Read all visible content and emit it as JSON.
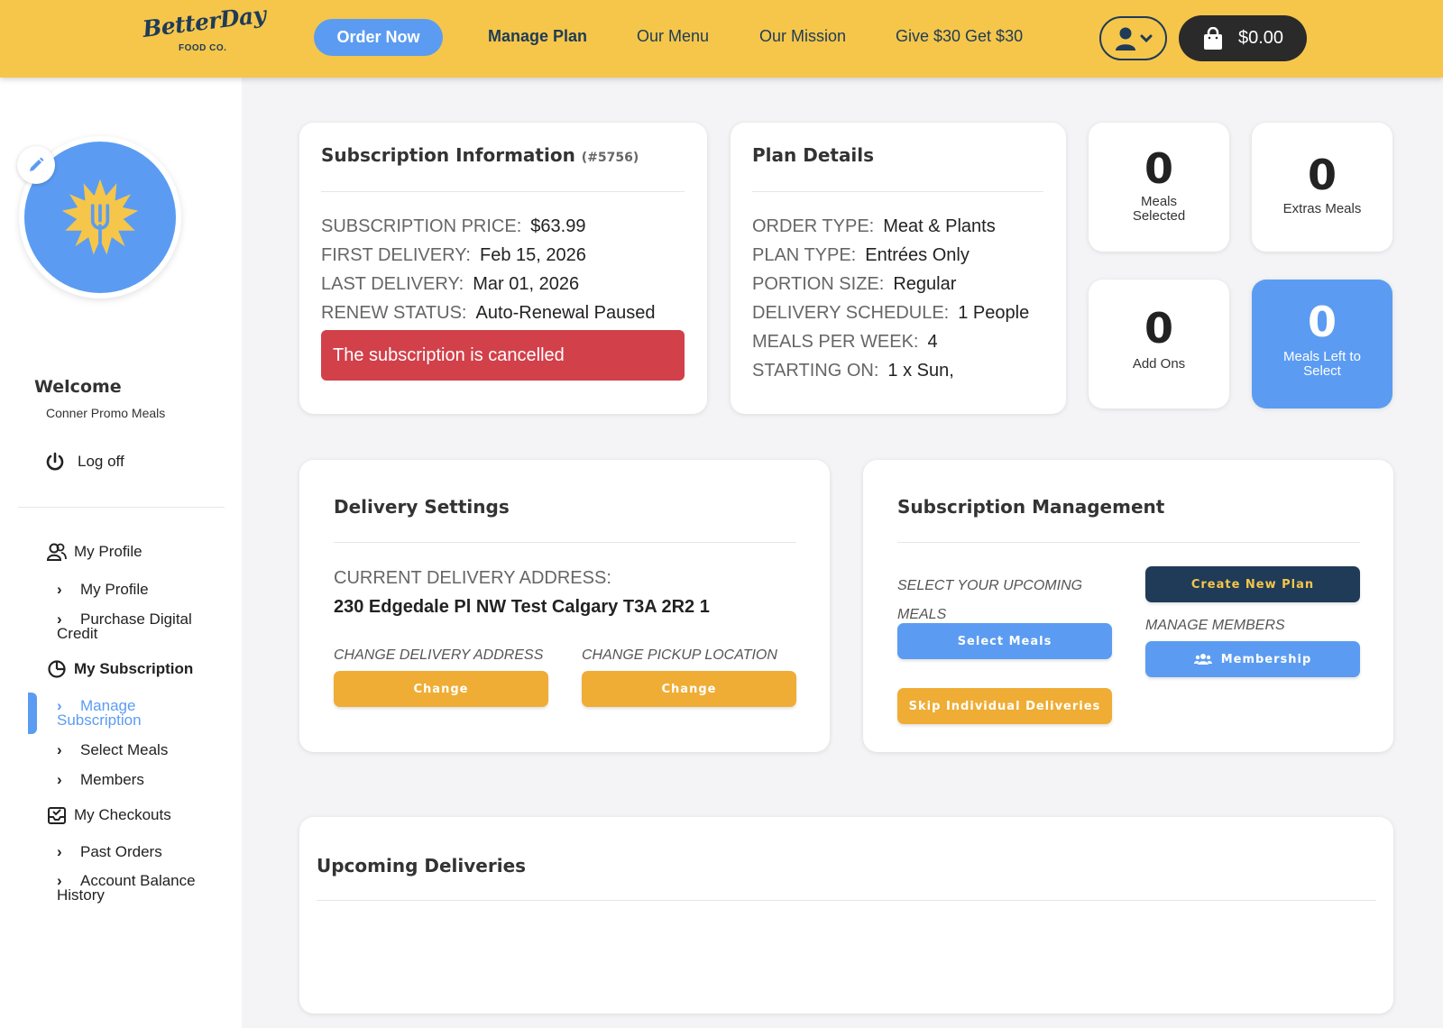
{
  "header": {
    "logo_main": "BetterDay",
    "logo_sub": "FOOD CO.",
    "order_now": "Order Now",
    "nav": [
      "Manage Plan",
      "Our Menu",
      "Our Mission",
      "Give $30 Get $30"
    ],
    "cart_total": "$0.00"
  },
  "colors": {
    "accent_yellow": "#f5c64a",
    "accent_blue": "#5b9cf2",
    "navy": "#1f3b57",
    "alert_red": "#d2404a",
    "button_orange": "#efad35"
  },
  "sidebar": {
    "welcome": "Welcome",
    "username": "Conner Promo Meals",
    "logoff": "Log off",
    "sections": [
      {
        "label": "My Profile",
        "icon": "users-icon"
      },
      {
        "label": "My Subscription",
        "icon": "pie-chart-icon"
      },
      {
        "label": "My Checkouts",
        "icon": "inbox-check-icon"
      }
    ],
    "subs": {
      "my_profile": "My Profile",
      "purchase_credit_1": "Purchase Digital",
      "purchase_credit_2": "Credit",
      "manage_sub_1": "Manage",
      "manage_sub_2": "Subscription",
      "select_meals": "Select Meals",
      "members": "Members",
      "past_orders": "Past Orders",
      "balance_history_1": "Account Balance",
      "balance_history_2": "History"
    }
  },
  "subscription": {
    "title": "Subscription Information",
    "id": "(#5756)",
    "rows": [
      {
        "label": "SUBSCRIPTION PRICE:",
        "value": "$63.99"
      },
      {
        "label": "FIRST DELIVERY:",
        "value": "Feb 15, 2026"
      },
      {
        "label": "LAST DELIVERY:",
        "value": "Mar 01, 2026"
      },
      {
        "label": "RENEW STATUS:",
        "value": "Auto-Renewal Paused"
      }
    ],
    "alert": "The subscription is cancelled"
  },
  "plan": {
    "title": "Plan Details",
    "rows": [
      {
        "label": "ORDER TYPE:",
        "value": "Meat & Plants"
      },
      {
        "label": "PLAN TYPE:",
        "value": "Entrées Only"
      },
      {
        "label": "PORTION SIZE:",
        "value": "Regular"
      },
      {
        "label": "DELIVERY SCHEDULE:",
        "value": "1 People"
      },
      {
        "label": "MEALS PER WEEK:",
        "value": "4"
      },
      {
        "label": "STARTING ON:",
        "value": "1 x Sun,"
      }
    ]
  },
  "stats": [
    {
      "value": "0",
      "label_1": "Meals",
      "label_2": "Selected"
    },
    {
      "value": "0",
      "label_1": "Extras Meals",
      "label_2": ""
    },
    {
      "value": "0",
      "label_1": "Add Ons",
      "label_2": ""
    },
    {
      "value": "0",
      "label_1": "Meals Left to",
      "label_2": "Select"
    }
  ],
  "delivery": {
    "title": "Delivery Settings",
    "address_label": "CURRENT DELIVERY ADDRESS:",
    "address": "230 Edgedale Pl NW Test Calgary T3A 2R2 1",
    "change_address_label": "CHANGE DELIVERY ADDRESS",
    "change_pickup_label": "CHANGE PICKUP LOCATION",
    "change_btn": "Change"
  },
  "management": {
    "title": "Subscription Management",
    "select_label_1": "SELECT YOUR UPCOMING",
    "select_label_2": "MEALS",
    "select_meals_btn": "Select Meals",
    "skip_btn": "Skip Individual Deliveries",
    "create_plan_btn": "Create New Plan",
    "members_label": "MANAGE MEMBERS",
    "membership_btn": "Membership"
  },
  "upcoming": {
    "title": "Upcoming Deliveries"
  }
}
